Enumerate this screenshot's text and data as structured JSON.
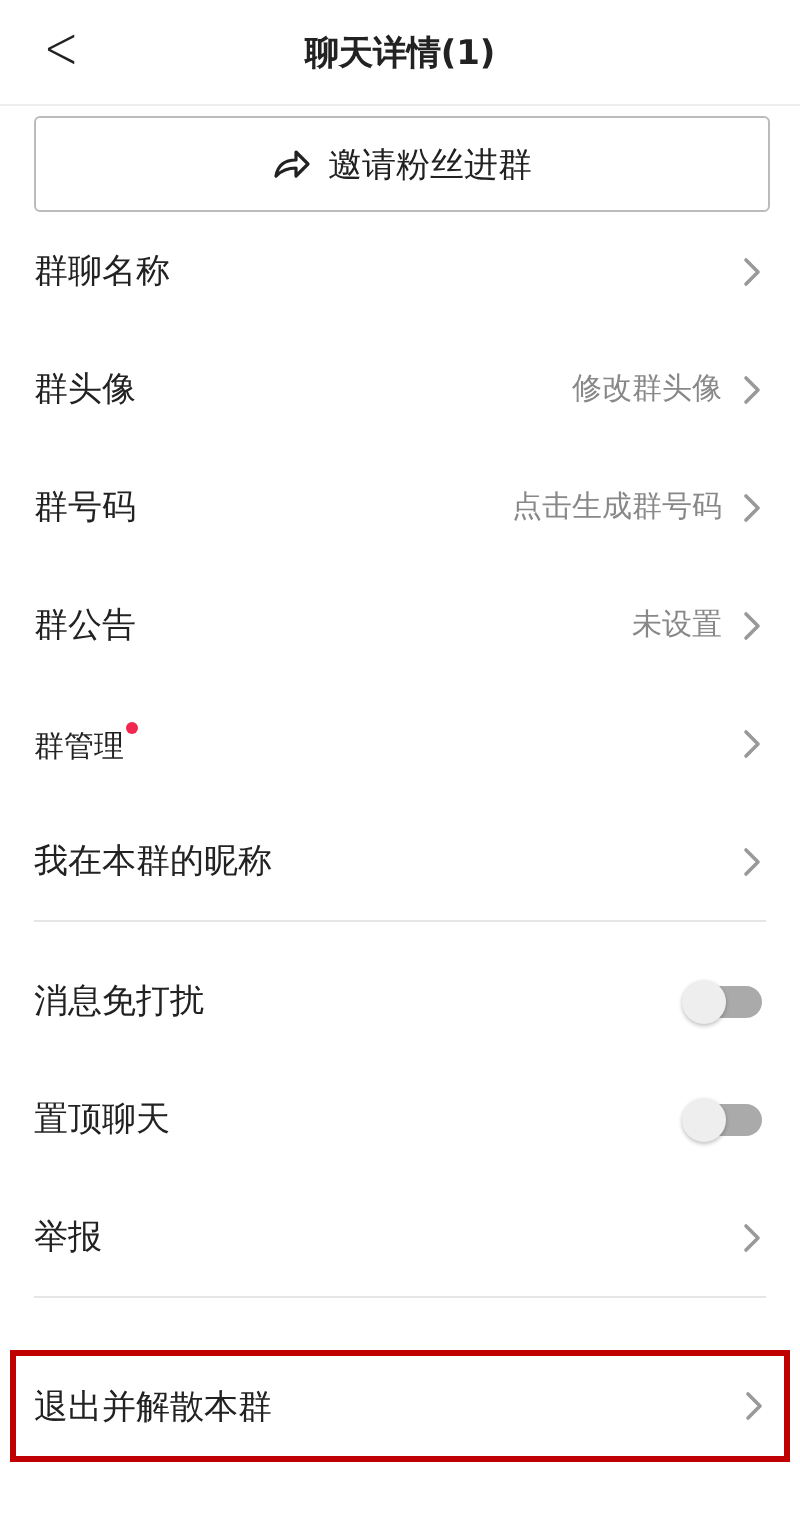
{
  "header": {
    "back": "<",
    "title": "聊天详情(1)"
  },
  "invite_button": {
    "label": "邀请粉丝进群"
  },
  "sections": [
    {
      "rows": [
        {
          "kind": "link",
          "label": "群聊名称"
        },
        {
          "kind": "link",
          "label": "群头像",
          "value": "修改群头像"
        },
        {
          "kind": "link",
          "label": "群号码",
          "value": "点击生成群号码"
        },
        {
          "kind": "link",
          "label": "群公告",
          "value": "未设置"
        },
        {
          "kind": "link",
          "label": "群管理",
          "badge": true,
          "small": true
        },
        {
          "kind": "link",
          "label": "我在本群的昵称"
        }
      ]
    },
    {
      "rows": [
        {
          "kind": "toggle",
          "label": "消息免打扰",
          "on": false
        },
        {
          "kind": "toggle",
          "label": "置顶聊天",
          "on": false
        },
        {
          "kind": "link",
          "label": "举报"
        }
      ]
    },
    {
      "rows": [
        {
          "kind": "link",
          "label": "退出并解散本群",
          "highlighted": true
        }
      ]
    }
  ]
}
